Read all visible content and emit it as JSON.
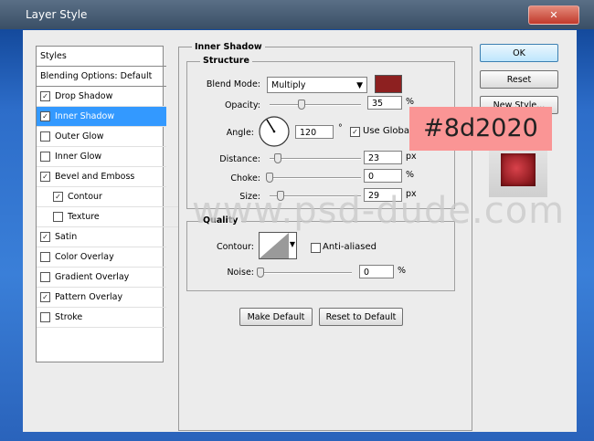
{
  "window": {
    "title": "Layer Style"
  },
  "styles_list": {
    "header": "Styles",
    "items": [
      {
        "label": "Blending Options: Default",
        "checkbox": false
      },
      {
        "label": "Drop Shadow",
        "checkbox": true,
        "checked": true
      },
      {
        "label": "Inner Shadow",
        "checkbox": true,
        "checked": true,
        "selected": true
      },
      {
        "label": "Outer Glow",
        "checkbox": true,
        "checked": false
      },
      {
        "label": "Inner Glow",
        "checkbox": true,
        "checked": false
      },
      {
        "label": "Bevel and Emboss",
        "checkbox": true,
        "checked": true
      },
      {
        "label": "Contour",
        "checkbox": true,
        "checked": true,
        "indent": true
      },
      {
        "label": "Texture",
        "checkbox": true,
        "checked": false,
        "indent": true
      },
      {
        "label": "Satin",
        "checkbox": true,
        "checked": true
      },
      {
        "label": "Color Overlay",
        "checkbox": true,
        "checked": false
      },
      {
        "label": "Gradient Overlay",
        "checkbox": true,
        "checked": false
      },
      {
        "label": "Pattern Overlay",
        "checkbox": true,
        "checked": true
      },
      {
        "label": "Stroke",
        "checkbox": true,
        "checked": false
      }
    ]
  },
  "panel": {
    "title": "Inner Shadow",
    "structure": {
      "title": "Structure",
      "blend_mode_label": "Blend Mode:",
      "blend_mode_value": "Multiply",
      "blend_color": "#8d2020",
      "opacity_label": "Opacity:",
      "opacity_value": "35",
      "opacity_unit": "%",
      "opacity_level": 35,
      "angle_label": "Angle:",
      "angle_value": "120",
      "angle_unit": "°",
      "use_global_light_label": "Use Global Light",
      "use_global_light": true,
      "distance_label": "Distance:",
      "distance_value": "23",
      "distance_unit": "px",
      "distance_level": 23,
      "choke_label": "Choke:",
      "choke_value": "0",
      "choke_unit": "%",
      "choke_level": 0,
      "size_label": "Size:",
      "size_value": "29",
      "size_unit": "px",
      "size_level": 29
    },
    "quality": {
      "title": "Quality",
      "contour_label": "Contour:",
      "anti_aliased_label": "Anti-aliased",
      "anti_aliased": false,
      "noise_label": "Noise:",
      "noise_value": "0",
      "noise_unit": "%",
      "noise_level": 0
    },
    "make_default_label": "Make Default",
    "reset_to_default_label": "Reset to Default"
  },
  "buttons": {
    "ok": "OK",
    "reset": "Reset",
    "new_style": "New Style...",
    "close": "✕"
  },
  "overlay": {
    "color_code": "#8d2020"
  },
  "watermark": "www.psd-dude.com"
}
